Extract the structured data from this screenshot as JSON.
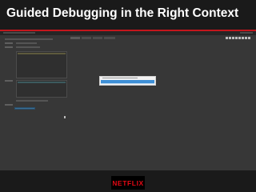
{
  "slide": {
    "title": "Guided Debugging in the Right Context"
  },
  "brand": {
    "logo": "NETFLIX",
    "logo_color": "#e50914"
  },
  "colors": {
    "accent_band": "#c4161c",
    "popup_highlight": "#3e8fd6",
    "run_button": "#3b6e94"
  },
  "icons": {
    "cursor": "mouse-pointer-icon",
    "toolbar": [
      "tool-icon",
      "tool-icon",
      "tool-icon",
      "tool-icon",
      "tool-icon",
      "tool-icon",
      "tool-icon",
      "tool-icon"
    ]
  }
}
